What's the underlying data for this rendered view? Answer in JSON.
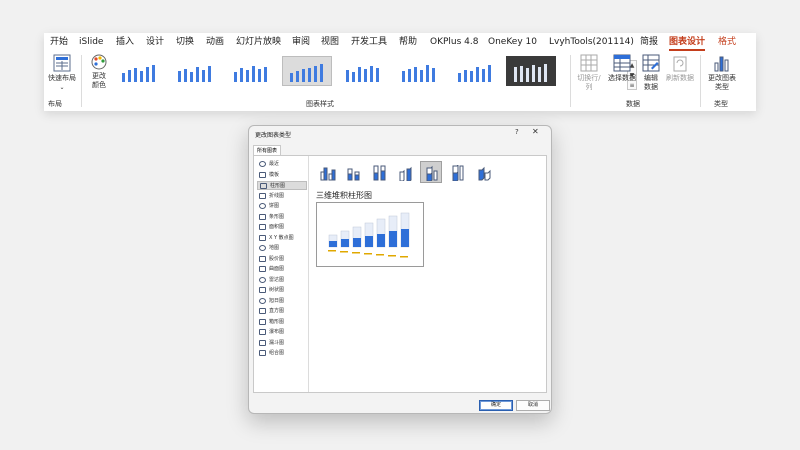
{
  "ribbon": {
    "tabs": [
      "开始",
      "iSlide",
      "插入",
      "设计",
      "切换",
      "动画",
      "幻灯片放映",
      "审阅",
      "视图",
      "开发工具",
      "帮助",
      "OKPlus 4.8",
      "OneKey 10",
      "LvyhTools(201114)",
      "简报",
      "图表设计",
      "格式"
    ],
    "active_tab": "图表设计",
    "quick_layout_label": "快速布局",
    "layout_group_label": "布局",
    "change_colors_label": "更改颜色",
    "styles_group_label": "图表样式",
    "data_buttons": [
      "切换行/列",
      "选择数据",
      "编辑数据",
      "刷新数据"
    ],
    "data_group_label": "数据",
    "change_type_label": "更改图表类型",
    "type_group_label": "类型",
    "accent_color": "#c43e1c"
  },
  "dialog": {
    "title": "更改图表类型",
    "help": "?",
    "close": "✕",
    "tab_label": "所有图表",
    "chart_types": [
      "最近",
      "模板",
      "柱形图",
      "折线图",
      "饼图",
      "条形图",
      "面积图",
      "X Y 散点图",
      "地图",
      "股价图",
      "曲面图",
      "雷达图",
      "树状图",
      "旭日图",
      "直方图",
      "箱形图",
      "瀑布图",
      "漏斗图",
      "组合图"
    ],
    "selected_type": "柱形图",
    "subtype_name": "三维堆积柱形图",
    "ok_label": "确定",
    "cancel_label": "取消",
    "bar_color": "#2e6fd8"
  }
}
